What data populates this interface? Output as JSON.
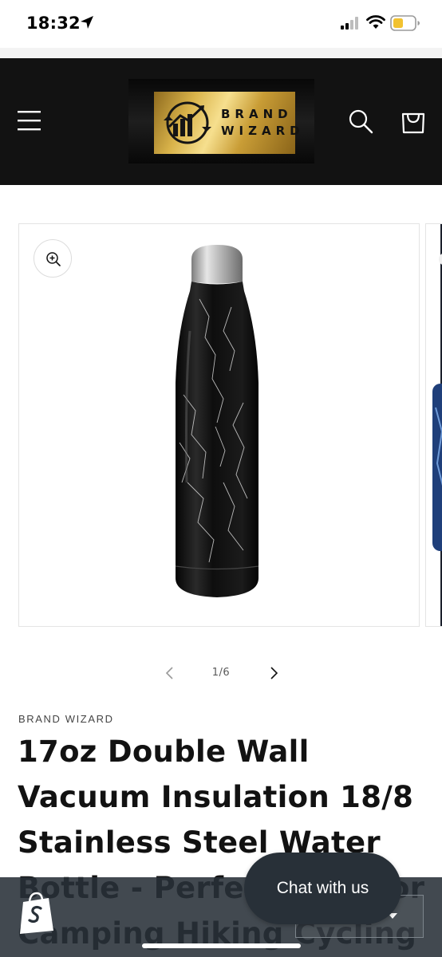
{
  "status_bar": {
    "time": "18:32",
    "icons": [
      "location-arrow-icon",
      "cellular-signal-icon",
      "wifi-icon",
      "battery-icon"
    ]
  },
  "header": {
    "logo_text": "BRAND WIZARD",
    "icons": [
      "menu-icon",
      "search-icon",
      "cart-icon"
    ]
  },
  "gallery": {
    "counter": "1/6",
    "icons": [
      "zoom-icon",
      "chevron-left-icon",
      "chevron-right-icon"
    ]
  },
  "product": {
    "vendor": "BRAND WIZARD",
    "title": "17oz Double Wall Vacuum Insulation 18/8 Stainless Steel Water Bottle - Perfect Outdoor Camping Hiking Cycling"
  },
  "chat": {
    "label": "Chat with us"
  },
  "bottom_bar": {
    "icons": [
      "shopify-bag-icon",
      "caret-down-icon"
    ]
  },
  "colors": {
    "header_bg": "#121212",
    "gold": "#d9b34a",
    "chat_bg": "#283038",
    "battery": "#f2c230"
  }
}
